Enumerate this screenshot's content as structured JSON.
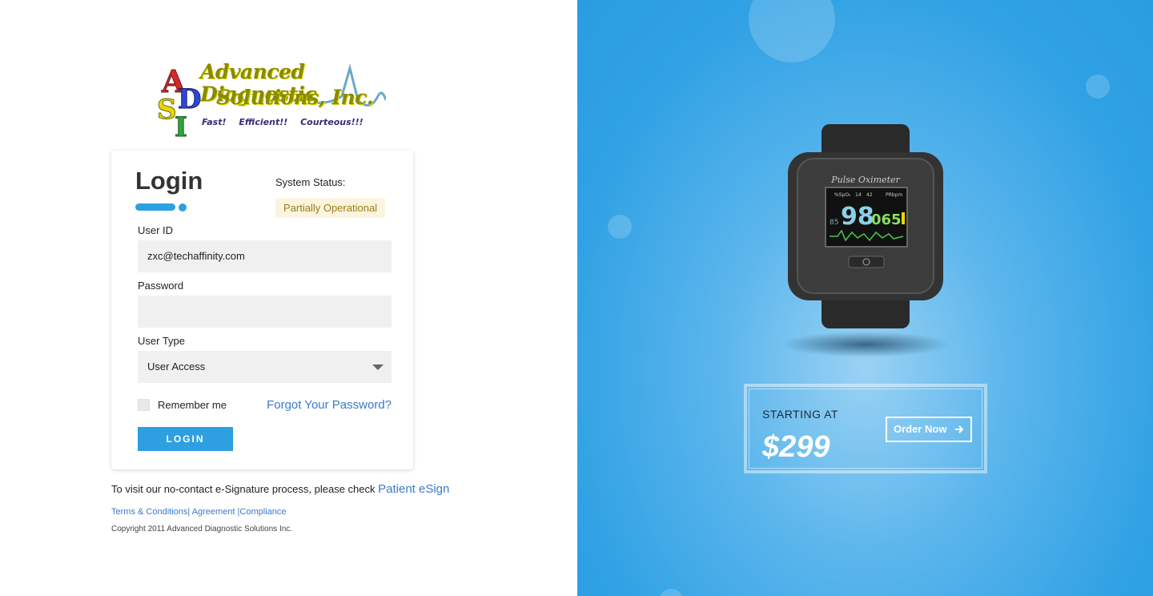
{
  "logo": {
    "line1": "Advanced Diagnostic",
    "line2": "Solutions, Inc.",
    "tagline": [
      "Fast!",
      "Efficient!!",
      "Courteous!!!"
    ],
    "mark_letters": "ADSI"
  },
  "login": {
    "title": "Login",
    "status_label": "System Status:",
    "status_value": "Partially Operational",
    "user_id_label": "User ID",
    "user_id_value": "zxc@techaffinity.com",
    "password_label": "Password",
    "password_value": "",
    "user_type_label": "User Type",
    "user_type_value": "User Access",
    "remember_label": "Remember me",
    "remember_checked": false,
    "forgot_label": "Forgot Your Password?",
    "login_button": "LOGIN"
  },
  "footer": {
    "esign_text": "To visit our no-contact e-Signature process, please check",
    "esign_link": "Patient eSign",
    "terms": "Terms & Conditions",
    "agreement": "Agreement",
    "compliance": "Compliance",
    "copyright": "Copyright 2011 Advanced Diagnostic Solutions Inc."
  },
  "promo": {
    "device_label": "Pulse Oximeter",
    "screen_spo2": "98",
    "screen_pr": "065",
    "screen_small": "85",
    "screen_hdr_spo2": "%SpO₂",
    "screen_hdr_a": "14",
    "screen_hdr_b": "42",
    "screen_hdr_pr": "PRbpm",
    "starting_at": "STARTING AT",
    "price": "$299",
    "order_button": "Order Now"
  },
  "colors": {
    "accent": "#2e9fe0",
    "link": "#3b7ac8",
    "status_bg": "#fbf4de",
    "status_text": "#9c7c16",
    "right_bg": "#2fa1e4"
  }
}
